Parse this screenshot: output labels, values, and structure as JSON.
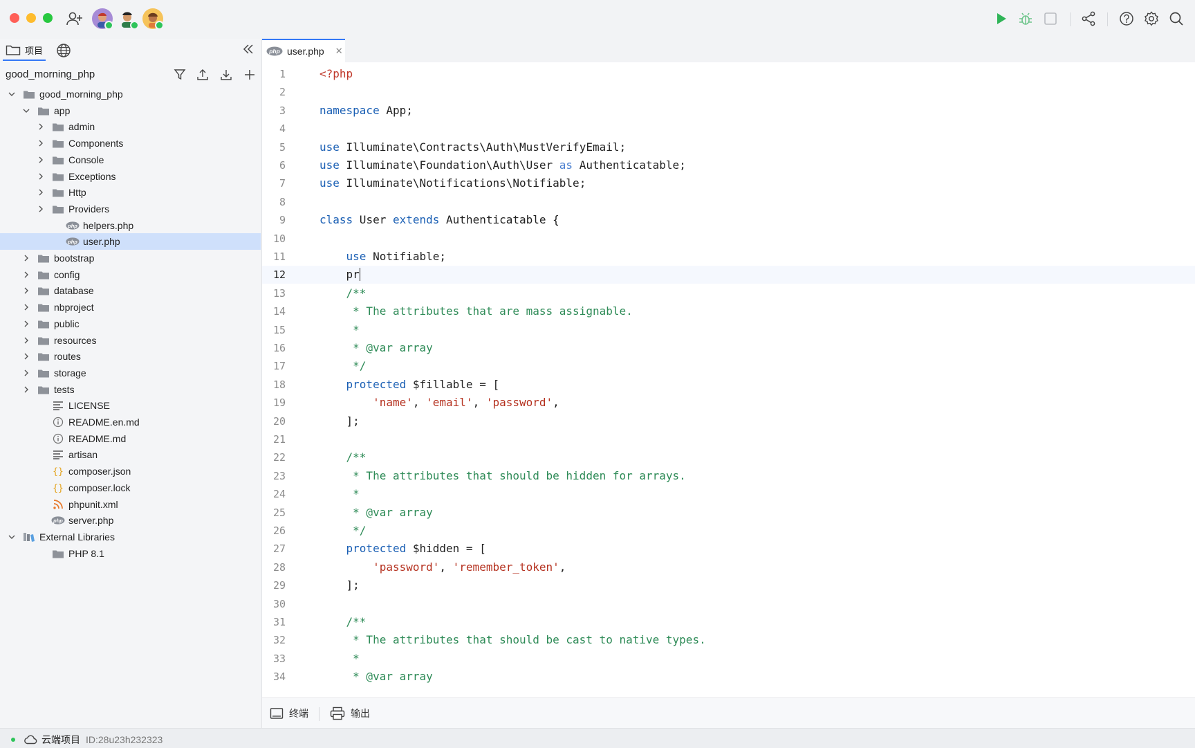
{
  "topbar": {
    "icons": [
      "add-user-icon",
      "run-icon",
      "debug-icon",
      "stop-icon",
      "share-icon",
      "help-icon",
      "settings-icon",
      "search-icon"
    ]
  },
  "sidebar": {
    "tab_project": "项目",
    "project_name": "good_morning_php",
    "tree": [
      {
        "label": "good_morning_php",
        "depth": 0,
        "type": "folder",
        "expanded": true
      },
      {
        "label": "app",
        "depth": 1,
        "type": "folder",
        "expanded": true
      },
      {
        "label": "admin",
        "depth": 2,
        "type": "folder",
        "expanded": false
      },
      {
        "label": "Components",
        "depth": 2,
        "type": "folder",
        "expanded": false
      },
      {
        "label": "Console",
        "depth": 2,
        "type": "folder",
        "expanded": false
      },
      {
        "label": "Exceptions",
        "depth": 2,
        "type": "folder",
        "expanded": false
      },
      {
        "label": "Http",
        "depth": 2,
        "type": "folder",
        "expanded": false
      },
      {
        "label": "Providers",
        "depth": 2,
        "type": "folder",
        "expanded": false
      },
      {
        "label": "helpers.php",
        "depth": 3,
        "type": "php"
      },
      {
        "label": "user.php",
        "depth": 3,
        "type": "php",
        "selected": true
      },
      {
        "label": "bootstrap",
        "depth": 1,
        "type": "folder",
        "expanded": false
      },
      {
        "label": "config",
        "depth": 1,
        "type": "folder",
        "expanded": false
      },
      {
        "label": "database",
        "depth": 1,
        "type": "folder",
        "expanded": false
      },
      {
        "label": "nbproject",
        "depth": 1,
        "type": "folder",
        "expanded": false
      },
      {
        "label": "public",
        "depth": 1,
        "type": "folder",
        "expanded": false
      },
      {
        "label": "resources",
        "depth": 1,
        "type": "folder",
        "expanded": false
      },
      {
        "label": "routes",
        "depth": 1,
        "type": "folder",
        "expanded": false
      },
      {
        "label": "storage",
        "depth": 1,
        "type": "folder",
        "expanded": false
      },
      {
        "label": "tests",
        "depth": 1,
        "type": "folder",
        "expanded": false
      },
      {
        "label": "LICENSE",
        "depth": 2,
        "type": "text"
      },
      {
        "label": "README.en.md",
        "depth": 2,
        "type": "info"
      },
      {
        "label": "README.md",
        "depth": 2,
        "type": "info"
      },
      {
        "label": "artisan",
        "depth": 2,
        "type": "text"
      },
      {
        "label": "composer.json",
        "depth": 2,
        "type": "json"
      },
      {
        "label": "composer.lock",
        "depth": 2,
        "type": "json"
      },
      {
        "label": "phpunit.xml",
        "depth": 2,
        "type": "rss"
      },
      {
        "label": "server.php",
        "depth": 2,
        "type": "php"
      },
      {
        "label": "External Libraries",
        "depth": 0,
        "type": "lib",
        "expanded": true
      },
      {
        "label": "PHP 8.1",
        "depth": 2,
        "type": "folder"
      }
    ]
  },
  "editor": {
    "tab_label": "user.php",
    "current_line": 12,
    "lines": [
      [
        [
          "<?php",
          "tag"
        ]
      ],
      [],
      [
        [
          "namespace",
          "kw"
        ],
        [
          " App;",
          "p"
        ]
      ],
      [],
      [
        [
          "use",
          "kw"
        ],
        [
          " Illuminate\\Contracts\\Auth\\MustVerifyEmail;",
          "p"
        ]
      ],
      [
        [
          "use",
          "kw"
        ],
        [
          " Illuminate\\Foundation\\Auth\\User ",
          "p"
        ],
        [
          "as",
          "kw2"
        ],
        [
          " Authenticatable;",
          "p"
        ]
      ],
      [
        [
          "use",
          "kw"
        ],
        [
          " Illuminate\\Notifications\\Notifiable;",
          "p"
        ]
      ],
      [],
      [
        [
          "class",
          "kw"
        ],
        [
          " User ",
          "p"
        ],
        [
          "extends",
          "kw"
        ],
        [
          " Authenticatable {",
          "p"
        ]
      ],
      [],
      [
        [
          "    ",
          "p"
        ],
        [
          "use",
          "kw"
        ],
        [
          " Notifiable;",
          "p"
        ]
      ],
      [
        [
          "    pr",
          "p"
        ]
      ],
      [
        [
          "    /**",
          "cm"
        ]
      ],
      [
        [
          "     * The attributes that are mass assignable.",
          "cm"
        ]
      ],
      [
        [
          "     *",
          "cm"
        ]
      ],
      [
        [
          "     * @var array",
          "cm"
        ]
      ],
      [
        [
          "     */",
          "cm"
        ]
      ],
      [
        [
          "    ",
          "p"
        ],
        [
          "protected",
          "kw"
        ],
        [
          " $fillable = [",
          "p"
        ]
      ],
      [
        [
          "        ",
          "p"
        ],
        [
          "'name'",
          "str"
        ],
        [
          ", ",
          "p"
        ],
        [
          "'email'",
          "str"
        ],
        [
          ", ",
          "p"
        ],
        [
          "'password'",
          "str"
        ],
        [
          ",",
          "p"
        ]
      ],
      [
        [
          "    ];",
          "p"
        ]
      ],
      [],
      [
        [
          "    /**",
          "cm"
        ]
      ],
      [
        [
          "     * The attributes that should be hidden for arrays.",
          "cm"
        ]
      ],
      [
        [
          "     *",
          "cm"
        ]
      ],
      [
        [
          "     * @var array",
          "cm"
        ]
      ],
      [
        [
          "     */",
          "cm"
        ]
      ],
      [
        [
          "    ",
          "p"
        ],
        [
          "protected",
          "kw"
        ],
        [
          " $hidden = [",
          "p"
        ]
      ],
      [
        [
          "        ",
          "p"
        ],
        [
          "'password'",
          "str"
        ],
        [
          ", ",
          "p"
        ],
        [
          "'remember_token'",
          "str"
        ],
        [
          ",",
          "p"
        ]
      ],
      [
        [
          "    ];",
          "p"
        ]
      ],
      [],
      [
        [
          "    /**",
          "cm"
        ]
      ],
      [
        [
          "     * The attributes that should be cast to native types.",
          "cm"
        ]
      ],
      [
        [
          "     *",
          "cm"
        ]
      ],
      [
        [
          "     * @var array",
          "cm"
        ]
      ]
    ]
  },
  "bottom": {
    "terminal_label": "终端",
    "output_label": "输出"
  },
  "status": {
    "cloud_label": "云端项目",
    "id_label": "ID:28u23h232323"
  },
  "colors": {
    "accent": "#3478f6",
    "keyword": "#1a5fb4",
    "keyword_alt": "#4a7fd0",
    "string": "#b5311f",
    "comment": "#2e8b57",
    "tag": "#c0392b",
    "selection": "#cfe0fb"
  }
}
